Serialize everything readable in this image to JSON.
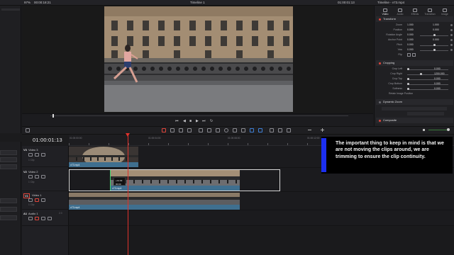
{
  "topbar": {
    "zoom": "97%",
    "timecode_left": "00:00:18:21",
    "timeline_name": "Timeline 1",
    "timecode_right": "01:00:01:13",
    "clip_name": "Timeline - v73.mp4"
  },
  "inspector": {
    "tabs": [
      "Video",
      "Audio",
      "Effects",
      "Transition",
      "Image"
    ],
    "sections": {
      "transform": "Transform",
      "cropping": "Cropping",
      "dynamic_zoom": "Dynamic Zoom",
      "composite": "Composite"
    },
    "transform_props": [
      {
        "label": "Zoom",
        "x": "1.000",
        "y": "1.000"
      },
      {
        "label": "Position",
        "x": "0.000",
        "y": "0.000"
      },
      {
        "label": "Rotation Angle",
        "x": "0.000",
        "y": ""
      },
      {
        "label": "Anchor Point",
        "x": "0.000",
        "y": "0.000"
      },
      {
        "label": "Pitch",
        "x": "0.000",
        "y": ""
      },
      {
        "label": "Yaw",
        "x": "0.000",
        "y": ""
      },
      {
        "label": "Flip",
        "x": "",
        "y": ""
      }
    ],
    "crop_props": [
      {
        "label": "Crop Left",
        "value": "0.000"
      },
      {
        "label": "Crop Right",
        "value": "1200.000"
      },
      {
        "label": "Crop Top",
        "value": "0.000"
      },
      {
        "label": "Crop Bottom",
        "value": "0.000"
      },
      {
        "label": "Softness",
        "value": "0.000"
      }
    ],
    "retain_label": "Retain Image Position"
  },
  "timeline": {
    "timecode": "01:00:01:13",
    "ruler_labels": [
      "01:00:00:00",
      "01:00:04:00",
      "01:00:08:00",
      "01:00:12:00",
      "01:00:16:00",
      "01:00:20:00",
      "01:00:24:00"
    ],
    "tracks": [
      {
        "id": "V3",
        "name": "Video 3",
        "sub": "1 Clip"
      },
      {
        "id": "V2",
        "name": "Video 2",
        "sub": "1 Clip"
      },
      {
        "id": "V1",
        "name": "Video 1",
        "sub": "1 Clip"
      },
      {
        "id": "A1",
        "name": "Audio 1",
        "sub": "2.0"
      }
    ],
    "clips": {
      "v3": "v73.mp4",
      "v2": "v73.mp4",
      "v1": "v73.mp4"
    },
    "tooltip_line1": "+01:09",
    "tooltip_line2": "00:00"
  },
  "callout": {
    "text": "The important thing to keep in mind is that we are not moving the clips around, we are trimming to ensure the clip continuity."
  },
  "colors": {
    "accent": "#1c2ff0",
    "playhead": "#e0322c",
    "clip_strip": "#3f6f8f"
  }
}
